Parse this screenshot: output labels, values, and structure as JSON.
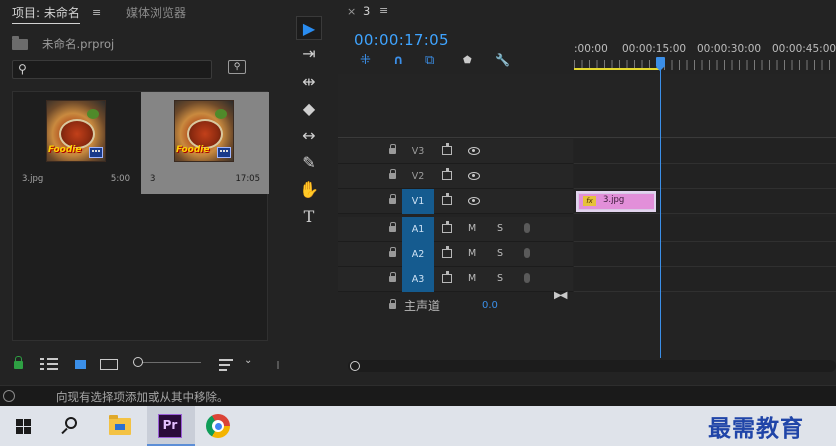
{
  "project_panel": {
    "tabs": [
      {
        "label": "项目: 未命名",
        "active": true
      },
      {
        "label": "媒体浏览器",
        "active": false
      }
    ],
    "menu_glyph": "≡",
    "project_file": "未命名.prproj",
    "search": {
      "value": "",
      "placeholder": ""
    },
    "media_items": [
      {
        "name": "3.jpg",
        "duration": "5:00",
        "thumb_caption": "Foodie",
        "selected": false
      },
      {
        "name": "3",
        "duration": "17:05",
        "thumb_caption": "Foodie",
        "selected": true
      }
    ],
    "footer_icons": [
      "lock-icon",
      "list-view-icon",
      "icon-view-icon",
      "freeform-view-icon",
      "zoom-slider",
      "sort-icon",
      "chevron-down-icon"
    ]
  },
  "tools": {
    "items": [
      {
        "name": "selection-tool-icon",
        "glyph": "▶",
        "active": true
      },
      {
        "name": "track-select-tool-icon",
        "glyph": "⇥",
        "active": false
      },
      {
        "name": "ripple-edit-tool-icon",
        "glyph": "⇹",
        "active": false
      },
      {
        "name": "razor-tool-icon",
        "glyph": "◆",
        "active": false
      },
      {
        "name": "slip-tool-icon",
        "glyph": "↔",
        "active": false
      },
      {
        "name": "pen-tool-icon",
        "glyph": "✎",
        "active": false
      },
      {
        "name": "hand-tool-icon",
        "glyph": "✋",
        "active": false
      },
      {
        "name": "type-tool-icon",
        "glyph": "T",
        "active": false
      }
    ]
  },
  "timeline": {
    "close_glyph": "×",
    "sequence_name": "3",
    "menu_glyph": "≡",
    "timecode": "00:00:17:05",
    "header_tools": [
      {
        "name": "nest-toggle-icon",
        "glyph": "⁜"
      },
      {
        "name": "snap-icon",
        "glyph": "∩"
      },
      {
        "name": "linked-selection-icon",
        "glyph": "⧉"
      },
      {
        "name": "add-marker-icon",
        "glyph": "⬟"
      },
      {
        "name": "settings-wrench-icon",
        "glyph": "🔧"
      }
    ],
    "ruler_labels": [
      ":00:00",
      "00:00:15:00",
      "00:00:30:00",
      "00:00:45:00"
    ],
    "playhead_position": "00:00:17:05",
    "video_tracks": [
      {
        "name": "V3",
        "target": false
      },
      {
        "name": "V2",
        "target": false
      },
      {
        "name": "V1",
        "target": true
      }
    ],
    "audio_tracks": [
      {
        "name": "A1",
        "target": true,
        "mute": "M",
        "solo": "S"
      },
      {
        "name": "A2",
        "target": true,
        "mute": "M",
        "solo": "S"
      },
      {
        "name": "A3",
        "target": true,
        "mute": "M",
        "solo": "S"
      }
    ],
    "clip": {
      "track": "V1",
      "name": "3.jpg",
      "fx": "fx"
    },
    "master": {
      "label": "主声道",
      "volume": "0.0",
      "end_glyph": "▶◀"
    }
  },
  "status_bar": {
    "text": "向现有选择项添加或从其中移除。"
  },
  "taskbar": {
    "items": [
      {
        "name": "start-button",
        "active": false
      },
      {
        "name": "search-button",
        "active": false
      },
      {
        "name": "file-explorer",
        "active": false
      },
      {
        "name": "premiere-pro",
        "label": "Pr",
        "active": true
      },
      {
        "name": "chrome",
        "active": false
      }
    ],
    "watermark": "最需教育"
  },
  "colors": {
    "accent_blue": "#3b8fe8",
    "target_track": "#155b8f",
    "clip_pink": "#e28fd9",
    "work_area_yellow": "#e3d72f",
    "lock_green": "#2ea043",
    "watermark_blue": "#2045a8"
  }
}
